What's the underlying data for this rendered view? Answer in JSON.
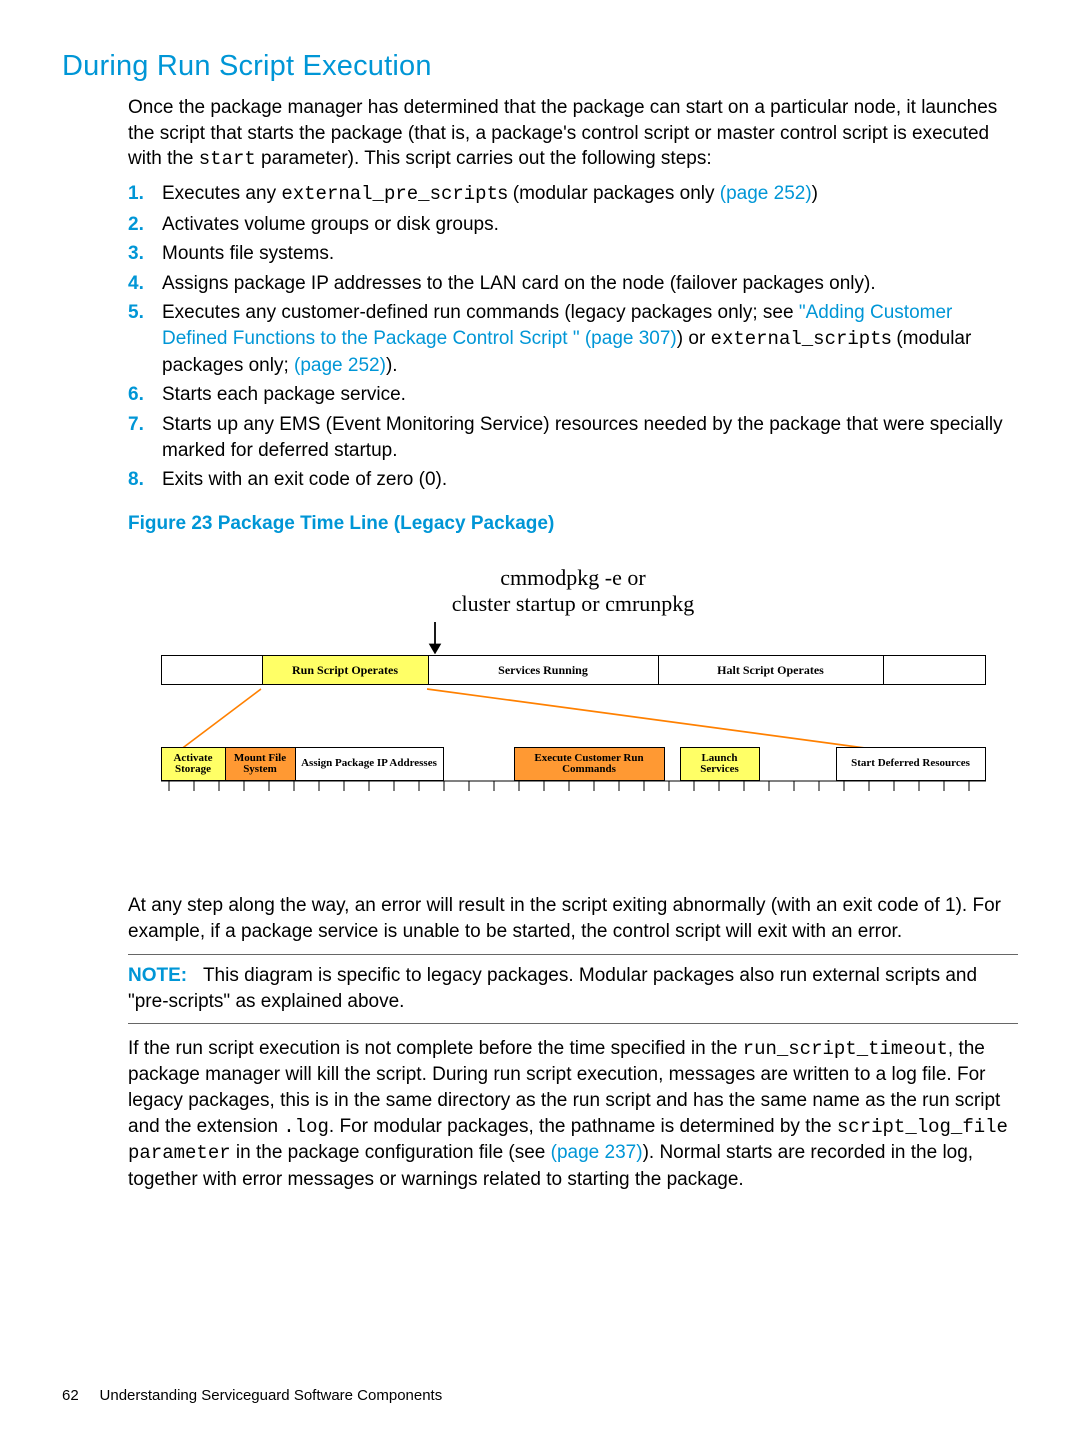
{
  "heading": "During Run Script Execution",
  "intro": {
    "part1": "Once the package manager has determined that the package can start on a particular node, it launches the script that starts the package (that is, a package's control script or master control script is executed with the ",
    "code1": "start",
    "part2": " parameter). This script carries out the following steps:"
  },
  "steps": [
    {
      "n": "1.",
      "pre": "Executes any ",
      "code": "external_pre_script",
      "post": "s (modular packages only ",
      "link": "(page 252)",
      "tail": ")"
    },
    {
      "n": "2.",
      "text": "Activates volume groups or disk groups."
    },
    {
      "n": "3.",
      "text": "Mounts file systems."
    },
    {
      "n": "4.",
      "text": "Assigns package IP addresses to the LAN card on the node (failover packages only)."
    },
    {
      "n": "5.",
      "pre": "Executes any customer-defined run commands (legacy packages only; see ",
      "link1": "\"Adding Customer Defined Functions to the Package Control Script \" (page 307)",
      "mid": ") or ",
      "code": "external_script",
      "post": "s (modular packages only; ",
      "link2": "(page 252)",
      "tail": ")."
    },
    {
      "n": "6.",
      "text": "Starts each package service."
    },
    {
      "n": "7.",
      "text": "Starts up any EMS (Event Monitoring Service) resources needed by the package that were specially marked for deferred startup."
    },
    {
      "n": "8.",
      "text": "Exits with an exit code of zero (0)."
    }
  ],
  "figure_caption": "Figure 23 Package Time Line (Legacy Package)",
  "diagram": {
    "title_line1": "cmmodpkg -e or",
    "title_line2": "cluster startup or cmrunpkg",
    "bar1": {
      "run": "Run Script Operates",
      "services": "Services Running",
      "halt": "Halt Script Operates"
    },
    "bar2": {
      "activate": "Activate Storage",
      "mount": "Mount File System",
      "assign": "Assign Package IP Addresses",
      "exec": "Execute Customer Run Commands",
      "launch": "Launch Services",
      "start_def": "Start Deferred Resources"
    }
  },
  "post_fig": "At any step along the way, an error will result in the script exiting abnormally (with an exit code of 1). For example, if a package service is unable to be started, the control script will exit with an error.",
  "note": {
    "label": "NOTE:",
    "text": "This diagram is specific to legacy packages. Modular packages also run external scripts and \"pre-scripts\" as explained above."
  },
  "para2": {
    "p1": "If the run script execution is not complete before the time specified in the ",
    "c1": "run_script_timeout",
    "p2": ", the package manager will kill the script. During run script execution, messages are written to a log file. For legacy packages, this is in the same directory as the run script and has the same name as the run script and the extension ",
    "c2": ".log",
    "p3": ". For modular packages, the pathname is determined by the ",
    "c3": "script_log_file parameter",
    "p4": " in the package configuration file (see ",
    "link": "(page 237)",
    "p5": "). Normal starts are recorded in the log, together with error messages or warnings related to starting the package."
  },
  "footer": {
    "page": "62",
    "title": "Understanding Serviceguard Software Components"
  }
}
